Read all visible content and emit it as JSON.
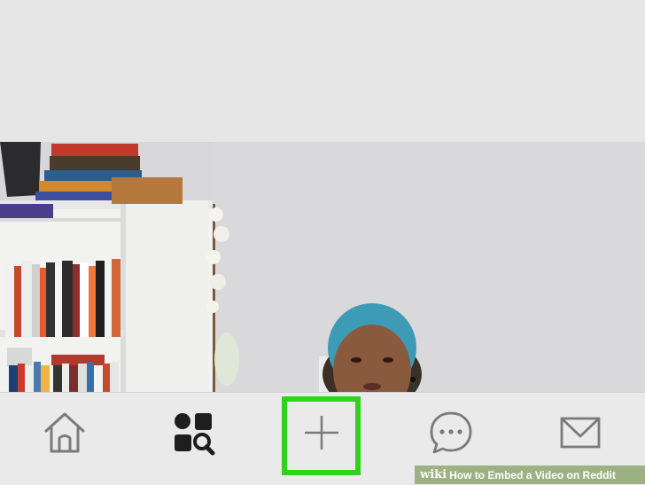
{
  "tabbar": {
    "tabs": [
      {
        "icon": "home-icon"
      },
      {
        "icon": "discover-icon"
      },
      {
        "icon": "plus-icon"
      },
      {
        "icon": "chat-icon"
      },
      {
        "icon": "mail-icon"
      }
    ],
    "highlighted_tab": "plus-icon",
    "highlight_color": "#33d11f"
  },
  "watermark": {
    "logo": "wiki",
    "title": "How to Embed a Video on Reddit"
  }
}
